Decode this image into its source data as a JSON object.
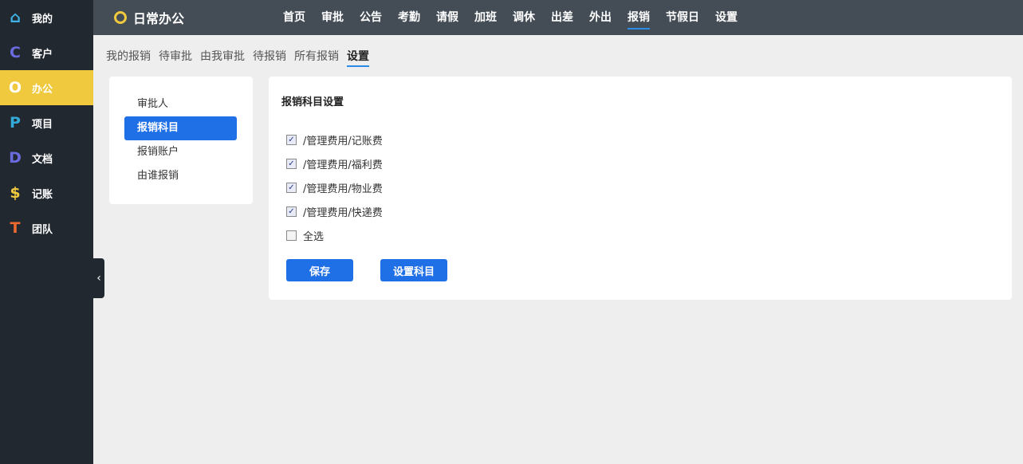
{
  "sidebar": {
    "items": [
      {
        "label": "我的",
        "icon": "⌂",
        "color": "#3fb3e6"
      },
      {
        "label": "客户",
        "icon": "C",
        "color": "#6b6be0"
      },
      {
        "label": "办公",
        "icon": "O",
        "color": "#ffffff"
      },
      {
        "label": "项目",
        "icon": "P",
        "color": "#33a9d8"
      },
      {
        "label": "文档",
        "icon": "D",
        "color": "#6b6be0"
      },
      {
        "label": "记账",
        "icon": "$",
        "color": "#f0c93e"
      },
      {
        "label": "团队",
        "icon": "T",
        "color": "#ee6a30"
      }
    ]
  },
  "header": {
    "title": "日常办公",
    "nav": [
      "首页",
      "审批",
      "公告",
      "考勤",
      "请假",
      "加班",
      "调休",
      "出差",
      "外出",
      "报销",
      "节假日",
      "设置"
    ]
  },
  "tabs": [
    "我的报销",
    "待审批",
    "由我审批",
    "待报销",
    "所有报销",
    "设置"
  ],
  "left_menu": [
    "审批人",
    "报销科目",
    "报销账户",
    "由谁报销"
  ],
  "panel": {
    "title": "报销科目设置",
    "items": [
      {
        "label": "/管理费用/记账费",
        "checked": true
      },
      {
        "label": "/管理费用/福利费",
        "checked": true
      },
      {
        "label": "/管理费用/物业费",
        "checked": true
      },
      {
        "label": "/管理费用/快递费",
        "checked": true
      },
      {
        "label": "全选",
        "checked": false
      }
    ],
    "save": "保存",
    "set_subjects": "设置科目"
  },
  "collapse_icon": "‹"
}
